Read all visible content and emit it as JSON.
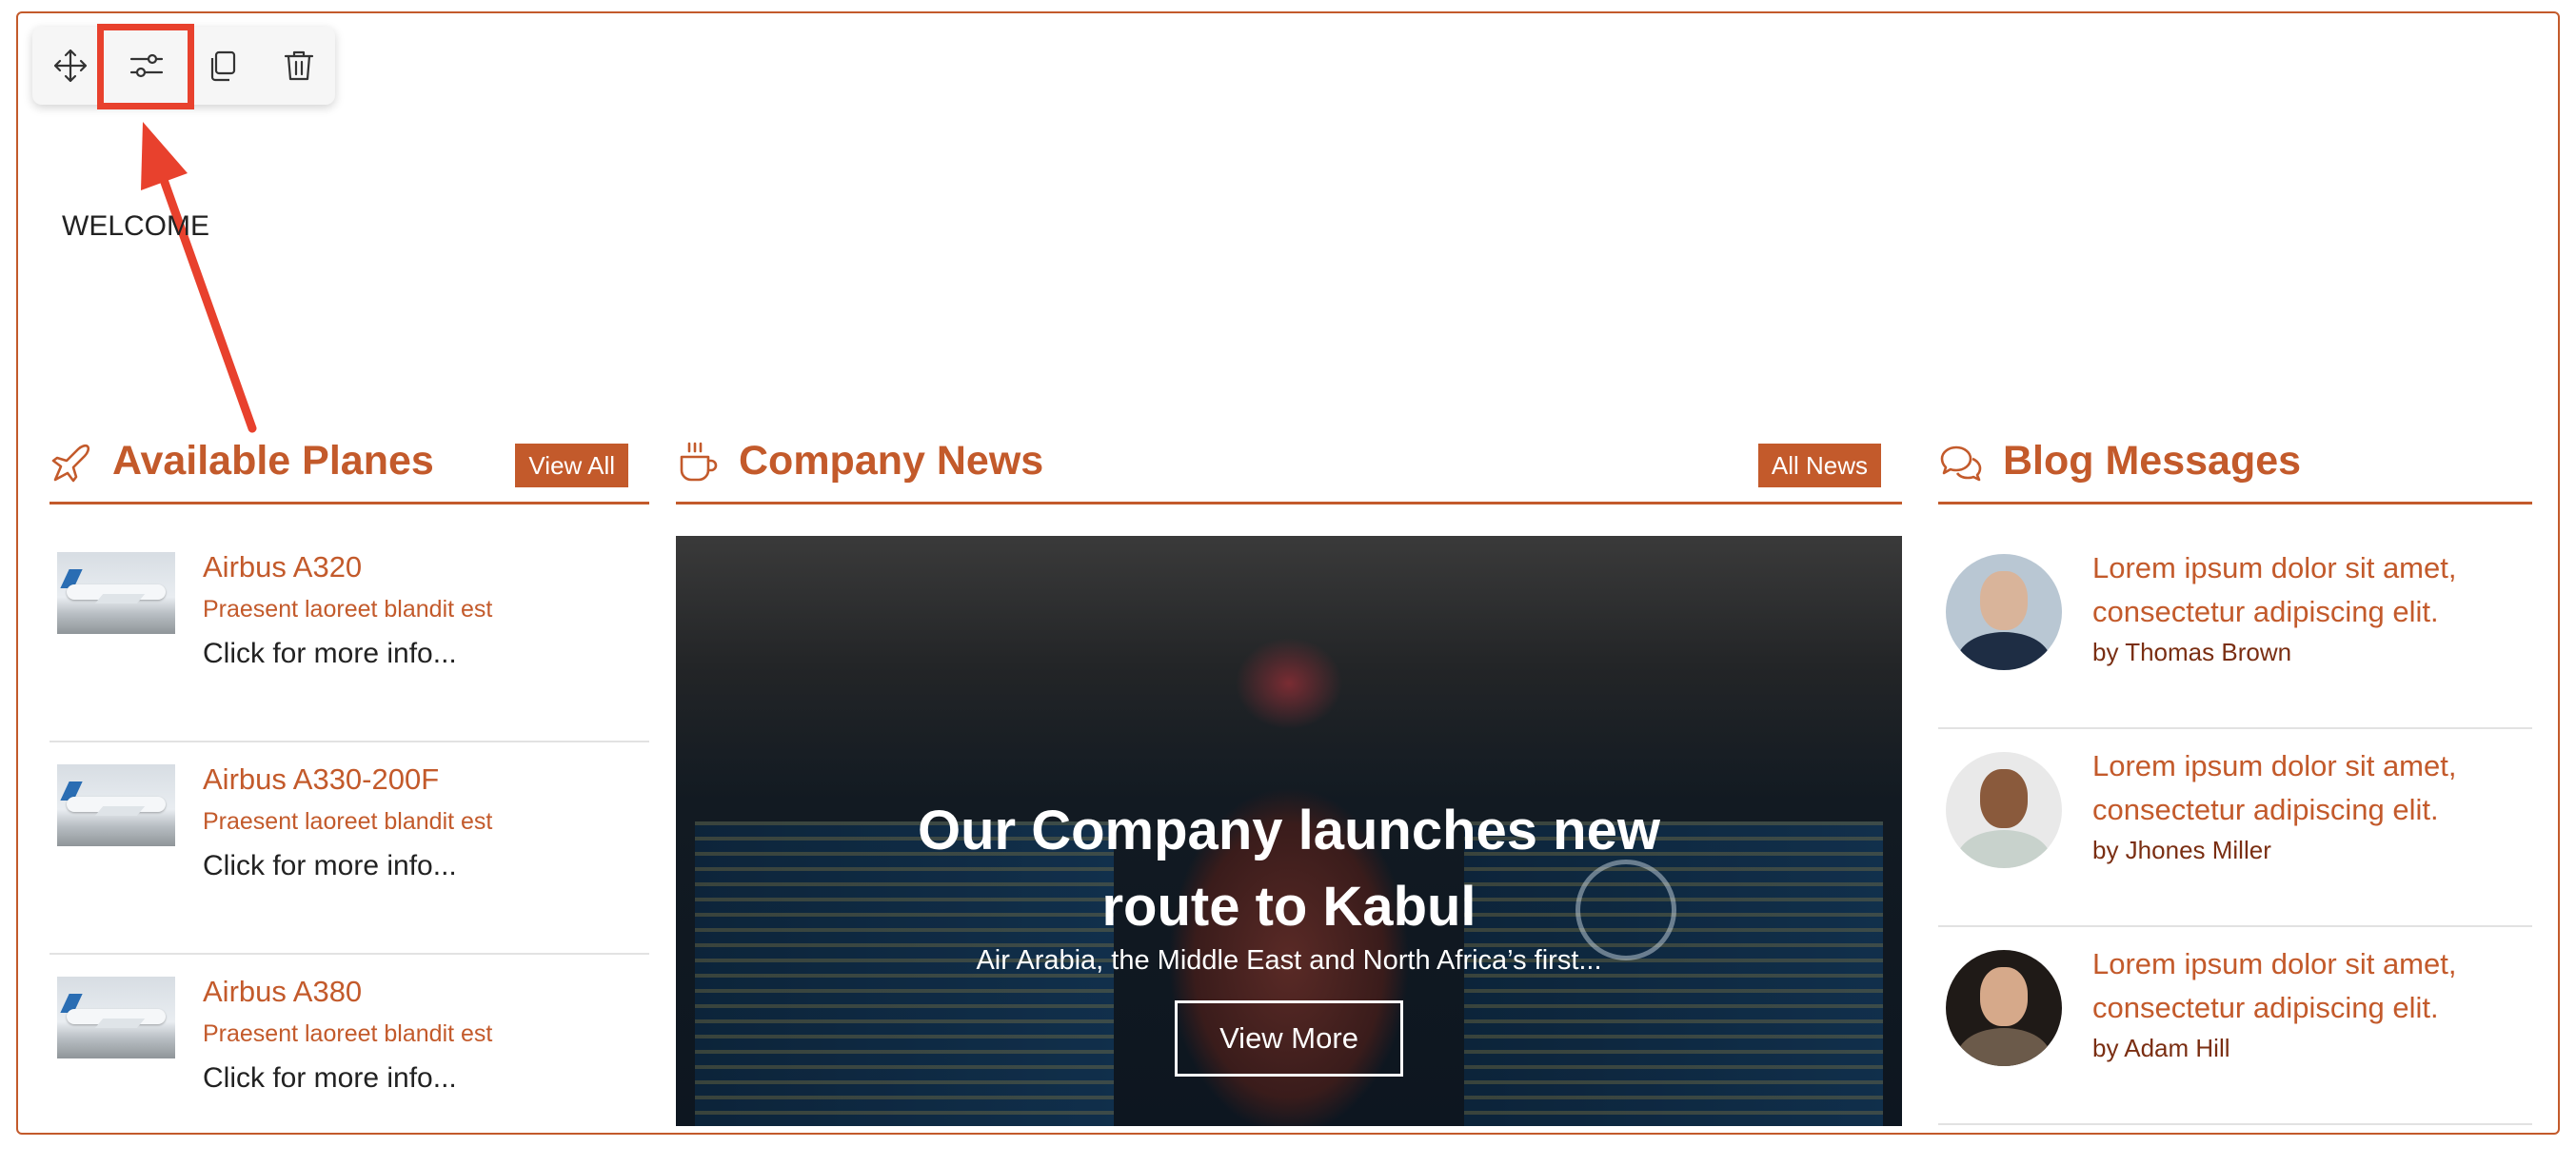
{
  "welcome": "WELCOME",
  "toolbar": {
    "icons": [
      "move-icon",
      "settings-sliders-icon",
      "duplicate-icon",
      "trash-icon"
    ]
  },
  "colors": {
    "accent": "#c35a2b",
    "highlight": "#e8412d"
  },
  "planes": {
    "title": "Available Planes",
    "button": "View All",
    "items": [
      {
        "name": "Airbus A320",
        "subtitle": "Praesent laoreet blandit est",
        "link": "Click for more info..."
      },
      {
        "name": "Airbus A330-200F",
        "subtitle": "Praesent laoreet blandit est",
        "link": "Click for more info..."
      },
      {
        "name": "Airbus A380",
        "subtitle": "Praesent laoreet blandit est",
        "link": "Click for more info..."
      }
    ]
  },
  "news": {
    "title": "Company News",
    "button": "All News",
    "headline_line1": "Our Company launches new",
    "headline_line2": "route to Kabul",
    "description": "Air Arabia, the Middle East and North Africa’s first...",
    "cta": "View More"
  },
  "blog": {
    "title": "Blog Messages",
    "items": [
      {
        "line1": "Lorem ipsum dolor sit amet,",
        "line2": "consectetur adipiscing elit.",
        "author": "by Thomas Brown"
      },
      {
        "line1": "Lorem ipsum dolor sit amet,",
        "line2": "consectetur adipiscing elit.",
        "author": "by Jhones Miller"
      },
      {
        "line1": "Lorem ipsum dolor sit amet,",
        "line2": "consectetur adipiscing elit.",
        "author": "by Adam Hill"
      }
    ]
  }
}
